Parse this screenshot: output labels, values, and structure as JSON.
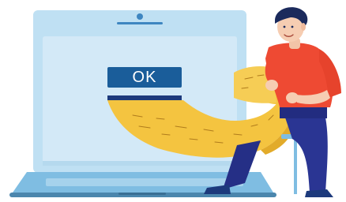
{
  "dialog": {
    "ok_label": "OK"
  },
  "icons": {
    "laptop": "laptop-illustration",
    "person": "person-illustration",
    "receipt": "paper-roll-illustration"
  },
  "colors": {
    "screen": "#cfe6f5",
    "laptop_frame": "#b9ddf1",
    "laptop_base": "#4b86ad",
    "button": "#1a5d9a",
    "paper": "#f3c443",
    "shirt": "#ef4b33",
    "pants": "#252f86"
  }
}
